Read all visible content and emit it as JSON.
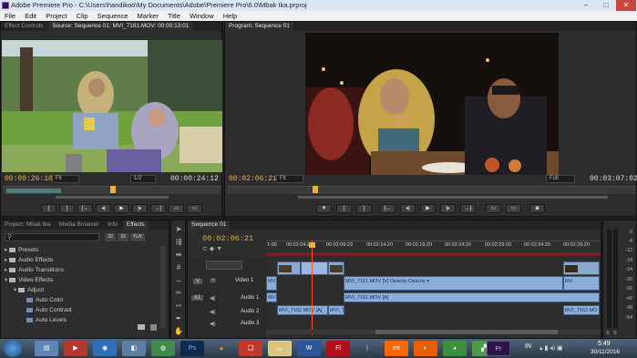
{
  "window": {
    "title": "Adobe Premiere Pro - C:\\Users\\handikoo\\My Documents\\Adobe\\Premiere Pro\\6.0\\Mbak Ika.prproj",
    "minimize": "–",
    "maximize": "□",
    "close": "✕"
  },
  "menu": [
    "File",
    "Edit",
    "Project",
    "Clip",
    "Sequence",
    "Marker",
    "Title",
    "Window",
    "Help"
  ],
  "source_panel": {
    "tabs": [
      "Effect Controls",
      "Source: Sequence 01: MVI_7161.MOV: 00:00:13:01"
    ],
    "timecode_in": "00:00:26:10",
    "timecode_out": "00:00:24:12",
    "fit": "Fit",
    "resolution": "1/2"
  },
  "program_panel": {
    "tabs": [
      "Program: Sequence 01"
    ],
    "timecode_in": "00:02:06:21",
    "timecode_out": "00:03:07:02",
    "fit": "Fit",
    "resolution": "Full"
  },
  "project_panel": {
    "tabs": [
      "Project: Mbak Ika",
      "Media Browser",
      "Info",
      "Effects"
    ],
    "items": [
      {
        "label": "Presets",
        "indent": 0,
        "type": "folder"
      },
      {
        "label": "Audio Effects",
        "indent": 0,
        "type": "folder"
      },
      {
        "label": "Audio Transitions",
        "indent": 0,
        "type": "folder"
      },
      {
        "label": "Video Effects",
        "indent": 0,
        "type": "folder"
      },
      {
        "label": "Adjust",
        "indent": 1,
        "type": "folder"
      },
      {
        "label": "Auto Color",
        "indent": 2,
        "type": "fx"
      },
      {
        "label": "Auto Contrast",
        "indent": 2,
        "type": "fx"
      },
      {
        "label": "Auto Levels",
        "indent": 2,
        "type": "fx"
      }
    ],
    "badges": [
      "32",
      "YUV"
    ]
  },
  "timeline": {
    "tab": "Sequence 01",
    "timecode": "00:02:06:21",
    "ruler": [
      "00:02:04:23",
      "00:02:09:23",
      "00:02:14:20",
      "00:02:19:20",
      "00:02:24:20",
      "00:02:29:20",
      "00:02:34:26",
      "00:02:39:20"
    ],
    "ruler_start": "1:00",
    "tracks": {
      "v2": "V",
      "video1": "Video 1",
      "a1": "A1",
      "audio1": "Audio 1",
      "audio2": "Audio 2",
      "audio3": "Audio 3"
    },
    "clips": {
      "v_left": "MV",
      "v_main": "MVI_7161.MOV [V] Opacity:Opacity ▾",
      "v_right": "MV",
      "a1_left": "MV",
      "a1_main": "MVI_7161.MOV [A]",
      "a2_left": "MVI_7162.MOV [A]",
      "a2_mid": "MVI_7",
      "a2_right": "MVI_7162.MO"
    }
  },
  "meter": {
    "ticks": [
      "0",
      "-6",
      "-12",
      "-18",
      "-24",
      "-30",
      "-36",
      "-42",
      "-48",
      "-54"
    ],
    "footer": [
      "S",
      "S"
    ]
  },
  "taskbar": {
    "apps": [
      "Explorer",
      "Media Player",
      "WMP",
      "Folder",
      "Network",
      "Photoshop",
      "VLC",
      "Books",
      "Files",
      "Word",
      "Flash",
      "Bluetooth",
      "Xiaomi",
      "Firefox",
      "Chrome",
      "Camtasia",
      "Premiere"
    ],
    "language": "IN",
    "time": "5:49",
    "date": "30/11/2016"
  },
  "colors": {
    "timecode": "#e8b33b",
    "clip_video": "#9cb7de",
    "clip_audio": "#8aaed9",
    "playhead": "#e8b33b"
  }
}
